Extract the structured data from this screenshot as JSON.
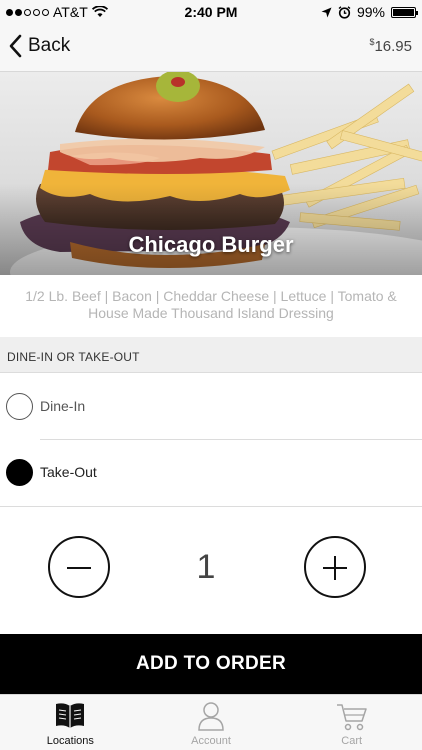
{
  "status_bar": {
    "carrier": "AT&T",
    "time": "2:40 PM",
    "battery": "99%",
    "battery_level": 0.99,
    "signal_bars": 2
  },
  "nav": {
    "back_label": "Back",
    "price_symbol": "$",
    "price_value": "16.95"
  },
  "item": {
    "name": "Chicago Burger",
    "description": "1/2 Lb. Beef | Bacon | Cheddar Cheese | Lettuce | Tomato & House Made Thousand Island Dressing"
  },
  "section": {
    "header": "DINE-IN OR TAKE-OUT",
    "options": [
      {
        "label": "Dine-In",
        "selected": false
      },
      {
        "label": "Take-Out",
        "selected": true
      }
    ]
  },
  "quantity": {
    "value": "1"
  },
  "cta": {
    "label": "ADD TO ORDER"
  },
  "tabbar": {
    "tabs": [
      {
        "label": "Locations",
        "icon": "book-icon",
        "active": true
      },
      {
        "label": "Account",
        "icon": "person-icon",
        "active": false
      },
      {
        "label": "Cart",
        "icon": "cart-icon",
        "active": false
      }
    ]
  },
  "colors": {
    "accent": "#000000",
    "muted_text": "#b5b5b5",
    "bar_background": "#f7f7f7"
  }
}
